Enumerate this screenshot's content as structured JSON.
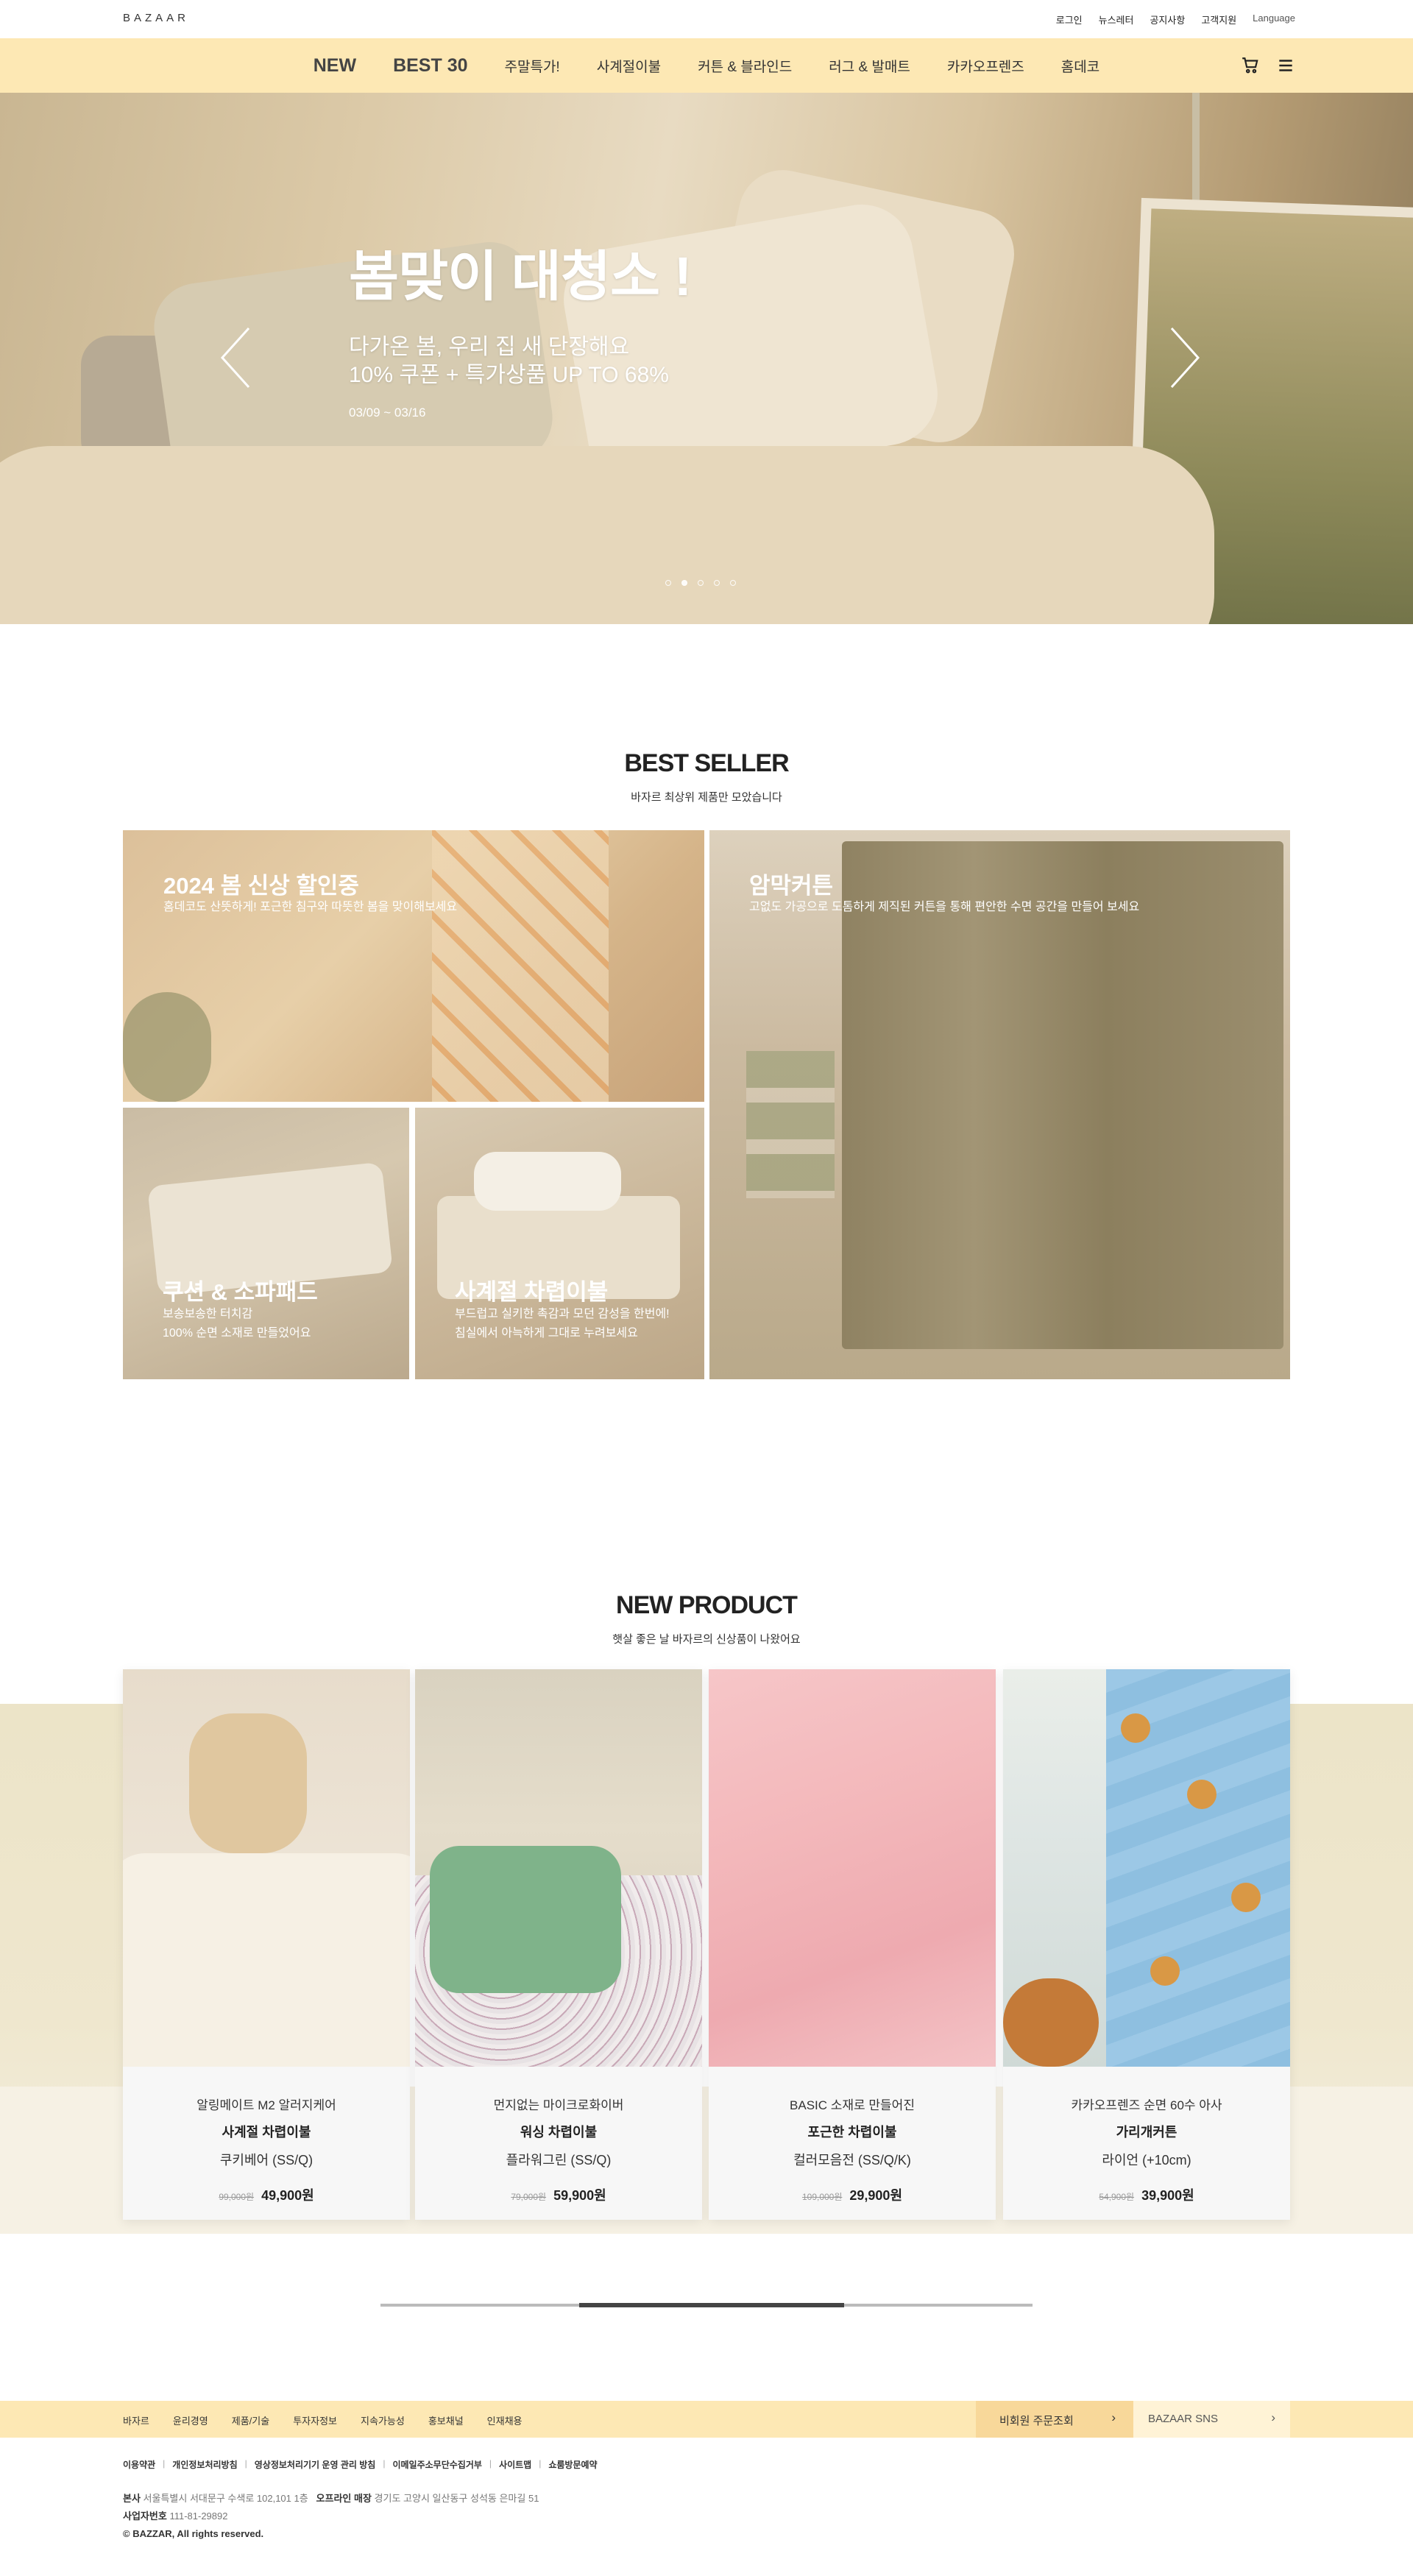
{
  "header": {
    "logo": "BAZAAR",
    "util_links": [
      "로그인",
      "뉴스레터",
      "공지사항",
      "고객지원",
      "Language"
    ]
  },
  "nav": {
    "items": [
      "NEW",
      "BEST 30",
      "주말특가!",
      "사계절이불",
      "커튼 & 블라인드",
      "러그 & 발매트",
      "카카오프렌즈",
      "홈데코"
    ],
    "icons": [
      "cart-icon",
      "menu-icon"
    ]
  },
  "hero": {
    "title": "봄맞이 대청소 !",
    "sub1": "다가온 봄, 우리 집 새 단장해요",
    "sub2": "10% 쿠폰 + 특가상품 UP TO 68%",
    "date": "03/09 ~ 03/16",
    "slide_count": 5,
    "active_slide": 2
  },
  "best_seller": {
    "title": "BEST SELLER",
    "subtitle": "바자르 최상위 제품만 모았습니다",
    "tiles": [
      {
        "title": "2024 봄 신상 할인중",
        "desc": "홈데코도 산뜻하게! 포근한 침구와 따뜻한 봄을 맞이해보세요"
      },
      {
        "title": "암막커튼",
        "desc": "고없도 가공으로 도톰하게 제직된 커튼을 통해 편안한 수면 공간을 만들어 보세요"
      },
      {
        "title": "쿠션 & 소파패드",
        "desc1": "보송보송한 터치감",
        "desc2": "100% 순면 소재로 만들었어요"
      },
      {
        "title": "사계절 차렵이불",
        "desc1": "부드럽고 실키한 촉감과 모던 감성을 한번에!",
        "desc2": "침실에서 아늑하게 그대로 누려보세요"
      }
    ]
  },
  "new_product": {
    "title": "NEW PRODUCT",
    "subtitle": "햇살 좋은 날 바자르의 신상품이 나왔어요",
    "products": [
      {
        "line1": "알링메이트 M2 알러지케어",
        "line2": "사계절 차렵이불",
        "line3": "쿠키베어 (SS/Q)",
        "old_price": "99,000원",
        "price": "49,900원"
      },
      {
        "line1": "먼지없는 마이크로화이버",
        "line2": "워싱 차렵이불",
        "line3": "플라워그린 (SS/Q)",
        "old_price": "79,000원",
        "price": "59,900원"
      },
      {
        "line1": "BASIC 소재로 만들어진",
        "line2": "포근한 차렵이불",
        "line3": "컬러모음전 (SS/Q/K)",
        "old_price": "109,000원",
        "price": "29,900원"
      },
      {
        "line1": "카카오프렌즈 순면 60수 아사",
        "line2": "가리개커튼",
        "line3": "라이언 (+10cm)",
        "old_price": "54,900원",
        "price": "39,900원"
      }
    ],
    "scroll_progress": 0.35
  },
  "footer": {
    "links": [
      "바자르",
      "윤리경영",
      "제품/기술",
      "투자자정보",
      "지속가능성",
      "홍보채널",
      "인재채용"
    ],
    "order_button": "비회원 주문조회",
    "sns_button": "BAZAAR SNS",
    "policies": [
      "이용약관",
      "개인정보처리방침",
      "영상정보처리기기 운영 관리 방침",
      "이메일주소무단수집거부",
      "사이트맵",
      "쇼룸방문예약"
    ],
    "hq_label": "본사",
    "hq_address": "서울특별시 서대문구 수색로 102,101 1층",
    "store_label": "오프라인 매장",
    "store_address": "경기도 고양시 일산동구 성석동 은마길 51",
    "biz_label": "사업자번호",
    "biz_number": "111-81-29892",
    "copyright": "© BAZZAR, All rights reserved."
  },
  "colors": {
    "nav_bg": "#fde8b4",
    "footer_order_bg": "#f8d89a"
  }
}
